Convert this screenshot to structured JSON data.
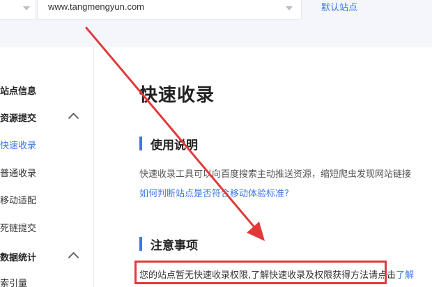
{
  "header": {
    "url": "www.tangmengyun.com",
    "default_site": "默认站点"
  },
  "sidebar": {
    "items": [
      {
        "label": "站点信息"
      },
      {
        "label": "资源提交"
      },
      {
        "label": "快速收录"
      },
      {
        "label": "普通收录"
      },
      {
        "label": "移动适配"
      },
      {
        "label": "死链提交"
      },
      {
        "label": "数据统计"
      },
      {
        "label": "索引量"
      }
    ]
  },
  "main": {
    "title": "快速收录",
    "usage": {
      "heading": "使用说明",
      "description": "快速收录工具可以向百度搜索主动推送资源，缩短爬虫发现网站链接",
      "link": "如何判断站点是否符合移动体验标准?"
    },
    "notice": {
      "heading": "注意事项",
      "message": "您的站点暂无快速收录权限,了解快速收录及权限获得方法",
      "tail": "请点击",
      "tail_link": "了解"
    }
  },
  "annotation": {
    "color": "#e03a3a"
  }
}
